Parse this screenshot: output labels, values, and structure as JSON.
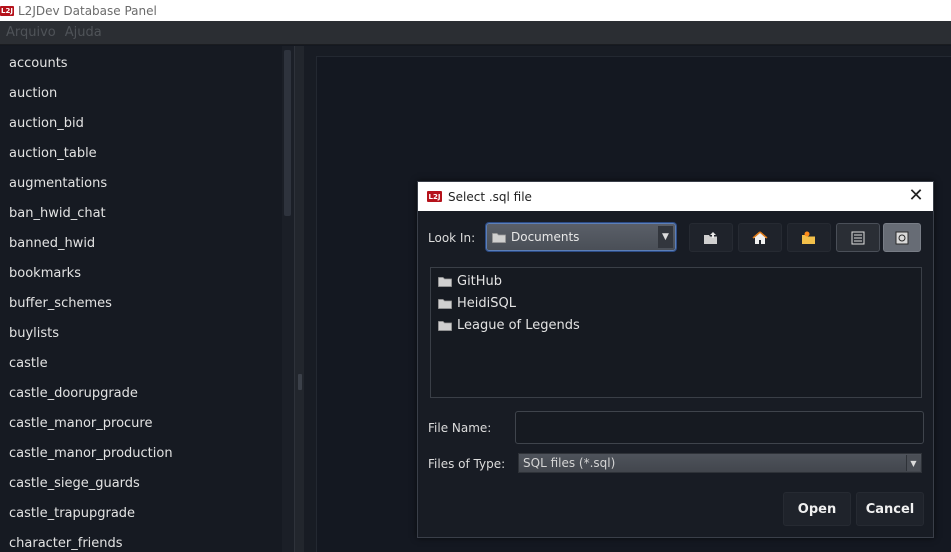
{
  "window": {
    "title": "L2JDev Database Panel",
    "logo_text": "L2J"
  },
  "menu": [
    {
      "label": "Arquivo"
    },
    {
      "label": "Ajuda"
    }
  ],
  "tables": [
    "accounts",
    "auction",
    "auction_bid",
    "auction_table",
    "augmentations",
    "ban_hwid_chat",
    "banned_hwid",
    "bookmarks",
    "buffer_schemes",
    "buylists",
    "castle",
    "castle_doorupgrade",
    "castle_manor_procure",
    "castle_manor_production",
    "castle_siege_guards",
    "castle_trapupgrade",
    "character_friends"
  ],
  "dialog": {
    "title": "Select .sql file",
    "logo_text": "L2J",
    "look_in_label": "Look In:",
    "look_in_value": "Documents",
    "toolbar_icons": [
      "up-folder-icon",
      "home-icon",
      "new-folder-icon",
      "list-view-icon",
      "details-view-icon"
    ],
    "folders": [
      {
        "name": "GitHub"
      },
      {
        "name": "HeidiSQL"
      },
      {
        "name": "League of Legends"
      }
    ],
    "file_name_label": "File Name:",
    "file_name_value": "",
    "file_type_label": "Files of Type:",
    "file_type_value": "SQL files (*.sql)",
    "open_label": "Open",
    "cancel_label": "Cancel"
  },
  "colors": {
    "accent_focus": "#5c7fb8",
    "logo_red": "#b5121b",
    "background": "#141820"
  }
}
